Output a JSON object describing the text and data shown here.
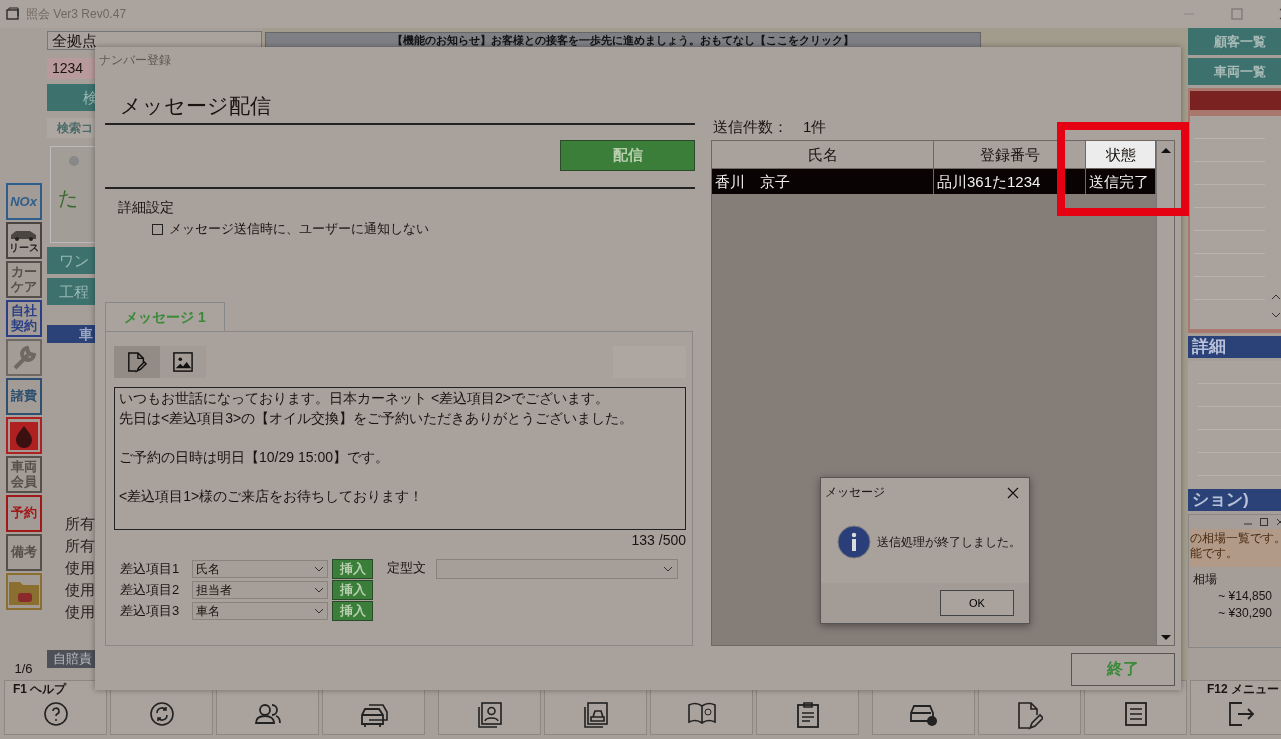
{
  "app": {
    "title": "照会 Ver3 Rev0.47",
    "location_select": "全拠点",
    "number_field": "1234",
    "notice": "【機能のお知らせ】お客様との接客を一歩先に進めましょう。おもてなし【ここをクリック】",
    "left_panel": {
      "search_bar": "検",
      "search_code": "検索コ",
      "plate_kana": "た",
      "buttons": [
        "ワン",
        "工程"
      ],
      "section": "車",
      "rows": [
        "所有",
        "所有",
        "使用",
        "使用",
        "使用"
      ],
      "footer_tab": "自賠責",
      "page": "1/6"
    },
    "sidebar": [
      {
        "kind": "nox",
        "label": "NOx",
        "color": "#2f5d8c"
      },
      {
        "kind": "car",
        "label": "リース",
        "color": "#4a4540"
      },
      {
        "kind": "text",
        "label": "カーケア",
        "color": "#56504a"
      },
      {
        "kind": "text",
        "label": "自社契約",
        "color": "#2b3f86"
      },
      {
        "kind": "wrench",
        "color": "#6e6862"
      },
      {
        "kind": "text",
        "label": "諸費",
        "color": "#2d5070"
      },
      {
        "kind": "drop",
        "color": "#b02020"
      },
      {
        "kind": "text",
        "label": "車両会員",
        "color": "#56504a"
      },
      {
        "kind": "text",
        "label": "予約",
        "color": "#a01818"
      },
      {
        "kind": "text",
        "label": "備考",
        "color": "#56504a"
      },
      {
        "kind": "folder",
        "color": "#8a6f30"
      }
    ],
    "right_panel": {
      "buttons": [
        "顧客一覧",
        "車両一覧"
      ],
      "detail_header": "詳細",
      "option_header": "ション)",
      "notes": [
        "の相場一覧です。",
        "能です。"
      ],
      "column": "相場",
      "prices": [
        "~ ¥14,850",
        "~ ¥30,290"
      ]
    },
    "function_keys": [
      {
        "kind": "help",
        "label": "F1 ヘルプ"
      },
      {
        "kind": "sync"
      },
      {
        "kind": "people"
      },
      {
        "kind": "cars"
      },
      {
        "kind": "portrait"
      },
      {
        "kind": "album"
      },
      {
        "kind": "book"
      },
      {
        "kind": "clipboard"
      },
      {
        "kind": "car-user"
      },
      {
        "kind": "doc-edit"
      },
      {
        "kind": "doc"
      },
      {
        "kind": "exit",
        "label": "F12 メニュー"
      }
    ]
  },
  "dialog": {
    "title": "ナンバー登録",
    "heading": "メッセージ配信",
    "send_button": "配信",
    "section": "詳細設定",
    "notify_option": {
      "label": "メッセージ送信時に、ユーザーに通知しない",
      "checked": false
    },
    "tabs": [
      {
        "label": "メッセージ 1",
        "selected": true
      }
    ],
    "editor_modes": [
      {
        "kind": "text",
        "selected": true
      },
      {
        "kind": "image",
        "selected": false
      }
    ],
    "message_paragraphs": [
      [
        "いつもお世話になっております。日本カーネット <差込項目2>でございます。",
        "先日は<差込項目3>の【オイル交換】をご予約いただきありがとうございました。"
      ],
      [
        "ご予約の日時は明日【10/29 15:00】です。"
      ],
      [
        "<差込項目1>様のご来店をお待ちしております！"
      ]
    ],
    "char_count": "133 /500",
    "inserts": [
      {
        "label": "差込項目1",
        "value": "氏名",
        "button": "挿入"
      },
      {
        "label": "差込項目2",
        "value": "担当者",
        "button": "挿入"
      },
      {
        "label": "差込項目3",
        "value": "車名",
        "button": "挿入"
      }
    ],
    "template_label": "定型文",
    "sent_count": "送信件数：　1件",
    "table": {
      "columns": [
        {
          "label": "氏名",
          "highlighted": false
        },
        {
          "label": "登録番号",
          "highlighted": false
        },
        {
          "label": "状態",
          "highlighted": true
        }
      ],
      "rows": [
        {
          "cells": [
            "香川　京子",
            "品川361た1234",
            "送信完了"
          ],
          "selected": true
        }
      ]
    },
    "close_button": "終了"
  },
  "message_box": {
    "title": "メッセージ",
    "text": "送信処理が終了しました。",
    "button": "OK"
  }
}
